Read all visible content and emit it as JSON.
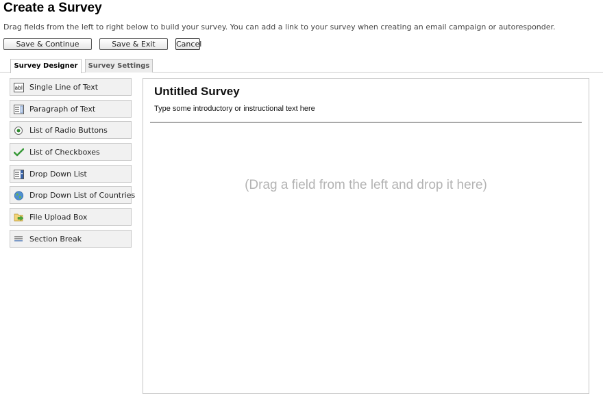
{
  "header": {
    "title": "Create a Survey",
    "intro": "Drag fields from the left to right below to build your survey. You can add a link to your survey when creating an email campaign or autoresponder."
  },
  "buttons": {
    "save_continue": "Save & Continue",
    "save_exit": "Save & Exit",
    "cancel": "Cancel"
  },
  "tabs": [
    {
      "label": "Survey Designer",
      "active": true
    },
    {
      "label": "Survey Settings",
      "active": false
    }
  ],
  "fields": [
    {
      "label": "Single Line of Text",
      "icon": "text-field-icon"
    },
    {
      "label": "Paragraph of Text",
      "icon": "paragraph-icon"
    },
    {
      "label": "List of Radio Buttons",
      "icon": "radio-button-icon"
    },
    {
      "label": "List of Checkboxes",
      "icon": "checkmark-icon"
    },
    {
      "label": "Drop Down List",
      "icon": "dropdown-icon"
    },
    {
      "label": "Drop Down List of Countries",
      "icon": "globe-icon"
    },
    {
      "label": "File Upload Box",
      "icon": "file-upload-icon"
    },
    {
      "label": "Section Break",
      "icon": "section-break-icon"
    }
  ],
  "survey": {
    "title": "Untitled Survey",
    "intro": "Type some introductory or instructional text here",
    "drop_hint": "(Drag a field from the left and drop it here)"
  }
}
